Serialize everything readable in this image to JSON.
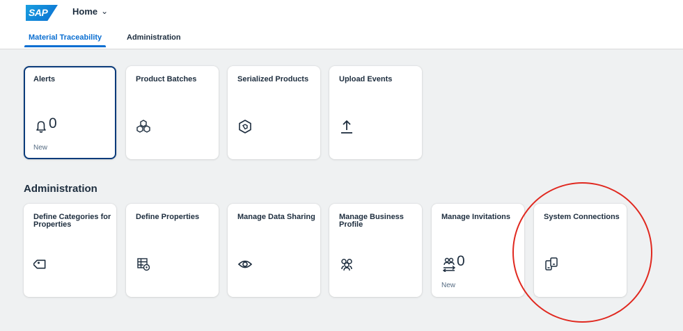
{
  "shell": {
    "logo_text": "SAP",
    "home_label": "Home"
  },
  "tabs": [
    {
      "label": "Material Traceability",
      "active": true
    },
    {
      "label": "Administration",
      "active": false
    }
  ],
  "groups": {
    "traceability": {
      "tiles": [
        {
          "title": "Alerts",
          "icon": "bell-icon",
          "count": "0",
          "footer": "New"
        },
        {
          "title": "Product Batches",
          "icon": "batches-icon"
        },
        {
          "title": "Serialized Products",
          "icon": "serialized-product-icon"
        },
        {
          "title": "Upload Events",
          "icon": "upload-icon"
        }
      ]
    },
    "administration": {
      "title": "Administration",
      "tiles": [
        {
          "title": "Define Categories for Properties",
          "icon": "tag-icon"
        },
        {
          "title": "Define Properties",
          "icon": "table-settings-icon"
        },
        {
          "title": "Manage Data Sharing",
          "icon": "eye-icon"
        },
        {
          "title": "Manage Business Profile",
          "icon": "group-icon"
        },
        {
          "title": "Manage Invitations",
          "icon": "people-exchange-icon",
          "count": "0",
          "footer": "New"
        },
        {
          "title": "System Connections",
          "icon": "connected-devices-icon"
        }
      ]
    }
  },
  "colors": {
    "brand_blue": "#0a6ed1",
    "highlight_circle": "#e0281f",
    "background": "#eff1f2"
  }
}
